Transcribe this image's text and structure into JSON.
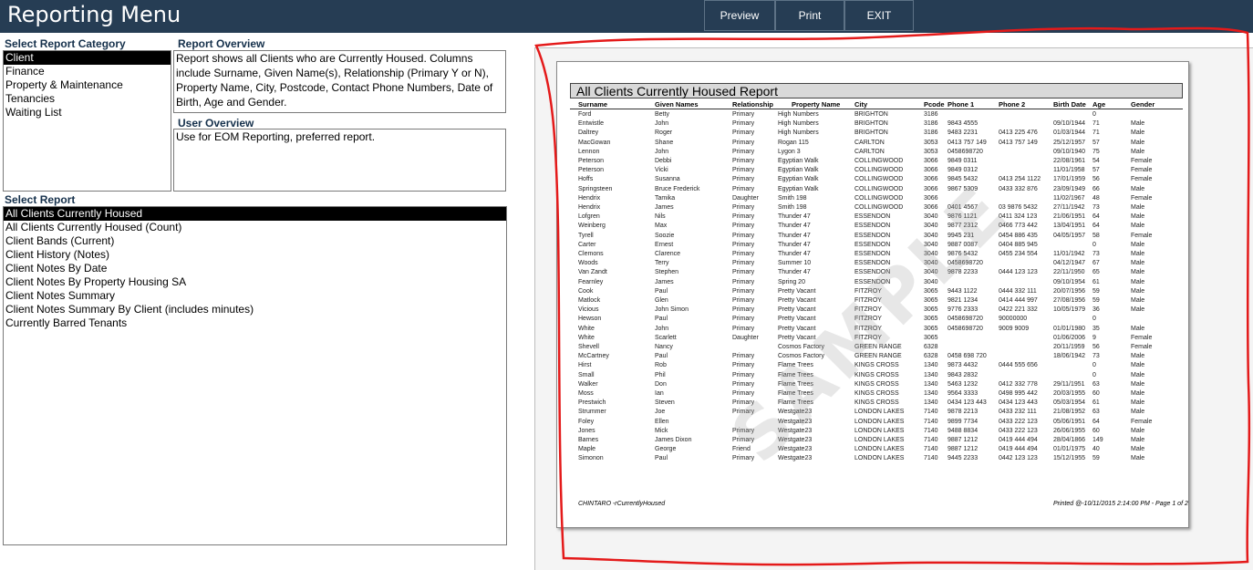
{
  "app_title": "Reporting Menu",
  "toolbar": {
    "preview": "Preview",
    "print": "Print",
    "exit": "EXIT"
  },
  "category": {
    "label": "Select Report Category",
    "items": [
      "Client",
      "Finance",
      "Property & Maintenance",
      "Tenancies",
      "Waiting List"
    ]
  },
  "overview": {
    "label": "Report Overview",
    "text": "Report shows all Clients who are Currently Housed. Columns include Surname, Given Name(s), Relationship (Primary Y or N), Property Name, City, Postcode, Contact Phone Numbers, Date of Birth, Age and Gender."
  },
  "user_overview": {
    "label": "User Overview",
    "text": "Use for EOM Reporting, preferred report."
  },
  "reports": {
    "label": "Select Report",
    "items": [
      "All Clients Currently Housed",
      "All Clients Currently Housed (Count)",
      "Client Bands (Current)",
      "Client History (Notes)",
      "Client Notes By Date",
      "Client Notes By Property Housing SA",
      "Client Notes Summary",
      "Client Notes Summary By Client (includes minutes)",
      "Currently Barred Tenants"
    ]
  },
  "preview": {
    "title": "All Clients Currently Housed Report",
    "columns": [
      "Surname",
      "Given Names",
      "Relationship",
      "Property Name",
      "City",
      "Pcode",
      "Phone 1",
      "Phone 2",
      "Birth Date",
      "Age",
      "Gender"
    ],
    "rows": [
      [
        "Ford",
        "Betty",
        "Primary",
        "High Numbers",
        "BRIGHTON",
        "3186",
        "",
        "",
        "",
        "0",
        ""
      ],
      [
        "Entwistle",
        "John",
        "Primary",
        "High Numbers",
        "BRIGHTON",
        "3186",
        "9843 4555",
        "",
        "09/10/1944",
        "71",
        "Male"
      ],
      [
        "Daltrey",
        "Roger",
        "Primary",
        "High Numbers",
        "BRIGHTON",
        "3186",
        "9483 2231",
        "0413 225 476",
        "01/03/1944",
        "71",
        "Male"
      ],
      [
        "MacGowan",
        "Shane",
        "Primary",
        "Rogan 115",
        "CARLTON",
        "3053",
        "0413 757 149",
        "0413 757 149",
        "25/12/1957",
        "57",
        "Male"
      ],
      [
        "Lennon",
        "John",
        "Primary",
        "Lygon 3",
        "CARLTON",
        "3053",
        "0458698720",
        "",
        "09/10/1940",
        "75",
        "Male"
      ],
      [
        "Peterson",
        "Debbi",
        "Primary",
        "Egyptian Walk",
        "COLLINGWOOD",
        "3066",
        "9849 0311",
        "",
        "22/08/1961",
        "54",
        "Female"
      ],
      [
        "Peterson",
        "Vicki",
        "Primary",
        "Egyptian Walk",
        "COLLINGWOOD",
        "3066",
        "9849 0312",
        "",
        "11/01/1958",
        "57",
        "Female"
      ],
      [
        "Hoffs",
        "Susanna",
        "Primary",
        "Egyptian Walk",
        "COLLINGWOOD",
        "3066",
        "9845 5432",
        "0413 254 1122",
        "17/01/1959",
        "56",
        "Female"
      ],
      [
        "Springsteen",
        "Bruce Frederick",
        "Primary",
        "Egyptian Walk",
        "COLLINGWOOD",
        "3066",
        "9867 5309",
        "0433 332 876",
        "23/09/1949",
        "66",
        "Male"
      ],
      [
        "Hendrix",
        "Tamika",
        "Daughter",
        "Smith 198",
        "COLLINGWOOD",
        "3066",
        "",
        "",
        "11/02/1967",
        "48",
        "Female"
      ],
      [
        "Hendrix",
        "James",
        "Primary",
        "Smith 198",
        "COLLINGWOOD",
        "3066",
        "0401 4567",
        "03 9876 5432",
        "27/11/1942",
        "73",
        "Male"
      ],
      [
        "Lofgren",
        "Nils",
        "Primary",
        "Thunder 47",
        "ESSENDON",
        "3040",
        "9876 1121",
        "0411 324 123",
        "21/06/1951",
        "64",
        "Male"
      ],
      [
        "Weinberg",
        "Max",
        "Primary",
        "Thunder 47",
        "ESSENDON",
        "3040",
        "9877 2312",
        "0466 773 442",
        "13/04/1951",
        "64",
        "Male"
      ],
      [
        "Tyrell",
        "Soozie",
        "Primary",
        "Thunder 47",
        "ESSENDON",
        "3040",
        "9945 231",
        "0454 886 435",
        "04/05/1957",
        "58",
        "Female"
      ],
      [
        "Carter",
        "Ernest",
        "Primary",
        "Thunder 47",
        "ESSENDON",
        "3040",
        "9887 0087",
        "0404 885 945",
        "",
        "0",
        "Male"
      ],
      [
        "Clemons",
        "Clarence",
        "Primary",
        "Thunder 47",
        "ESSENDON",
        "3040",
        "9876 5432",
        "0455 234 554",
        "11/01/1942",
        "73",
        "Male"
      ],
      [
        "Woods",
        "Terry",
        "Primary",
        "Summer 10",
        "ESSENDON",
        "3040",
        "0458698720",
        "",
        "04/12/1947",
        "67",
        "Male"
      ],
      [
        "Van Zandt",
        "Stephen",
        "Primary",
        "Thunder 47",
        "ESSENDON",
        "3040",
        "9878 2233",
        "0444 123 123",
        "22/11/1950",
        "65",
        "Male"
      ],
      [
        "Fearnley",
        "James",
        "Primary",
        "Spring 20",
        "ESSENDON",
        "3040",
        "",
        "",
        "09/10/1954",
        "61",
        "Male"
      ],
      [
        "Cook",
        "Paul",
        "Primary",
        "Pretty Vacant",
        "FITZROY",
        "3065",
        "9443 1122",
        "0444 332 111",
        "20/07/1956",
        "59",
        "Male"
      ],
      [
        "Matlock",
        "Glen",
        "Primary",
        "Pretty Vacant",
        "FITZROY",
        "3065",
        "9821 1234",
        "0414 444 997",
        "27/08/1956",
        "59",
        "Male"
      ],
      [
        "Vicious",
        "John Simon",
        "Primary",
        "Pretty Vacant",
        "FITZROY",
        "3065",
        "9776 2333",
        "0422 221 332",
        "10/05/1979",
        "36",
        "Male"
      ],
      [
        "Hewson",
        "Paul",
        "Primary",
        "Pretty Vacant",
        "FITZROY",
        "3065",
        "0458698720",
        "90000000",
        "",
        "0",
        ""
      ],
      [
        "White",
        "John",
        "Primary",
        "Pretty Vacant",
        "FITZROY",
        "3065",
        "0458698720",
        "9009 9009",
        "01/01/1980",
        "35",
        "Male"
      ],
      [
        "White",
        "Scarlett",
        "Daughter",
        "Pretty Vacant",
        "FITZROY",
        "3065",
        "",
        "",
        "01/06/2006",
        "9",
        "Female"
      ],
      [
        "Shevell",
        "Nancy",
        "",
        "Cosmos Factory",
        "GREEN RANGE",
        "6328",
        "",
        "",
        "20/11/1959",
        "56",
        "Female"
      ],
      [
        "McCartney",
        "Paul",
        "Primary",
        "Cosmos Factory",
        "GREEN RANGE",
        "6328",
        "0458 698 720",
        "",
        "18/06/1942",
        "73",
        "Male"
      ],
      [
        "Hirst",
        "Rob",
        "Primary",
        "Flame Trees",
        "KINGS CROSS",
        "1340",
        "9873 4432",
        "0444 555 656",
        "",
        "0",
        "Male"
      ],
      [
        "Small",
        "Phil",
        "Primary",
        "Flame Trees",
        "KINGS CROSS",
        "1340",
        "9843 2832",
        "",
        "",
        "0",
        "Male"
      ],
      [
        "Walker",
        "Don",
        "Primary",
        "Flame Trees",
        "KINGS CROSS",
        "1340",
        "5463 1232",
        "0412 332 778",
        "29/11/1951",
        "63",
        "Male"
      ],
      [
        "Moss",
        "Ian",
        "Primary",
        "Flame Trees",
        "KINGS CROSS",
        "1340",
        "9564 3333",
        "0498 995 442",
        "20/03/1955",
        "60",
        "Male"
      ],
      [
        "Prestwich",
        "Steven",
        "Primary",
        "Flame Trees",
        "KINGS CROSS",
        "1340",
        "0434 123 443",
        "0434 123 443",
        "05/03/1954",
        "61",
        "Male"
      ],
      [
        "Strummer",
        "Joe",
        "Primary",
        "Westgate23",
        "LONDON LAKES",
        "7140",
        "9878 2213",
        "0433 232 111",
        "21/08/1952",
        "63",
        "Male"
      ],
      [
        "Foley",
        "Ellen",
        "",
        "Westgate23",
        "LONDON LAKES",
        "7140",
        "9899 7734",
        "0433 222 123",
        "05/06/1951",
        "64",
        "Female"
      ],
      [
        "Jones",
        "Mick",
        "Primary",
        "Westgate23",
        "LONDON LAKES",
        "7140",
        "9488 8834",
        "0433 222 123",
        "26/06/1955",
        "60",
        "Male"
      ],
      [
        "Barnes",
        "James Dixon",
        "Primary",
        "Westgate23",
        "LONDON LAKES",
        "7140",
        "9887 1212",
        "0419 444 494",
        "28/04/1866",
        "149",
        "Male"
      ],
      [
        "Maple",
        "George",
        "Friend",
        "Westgate23",
        "LONDON LAKES",
        "7140",
        "9887 1212",
        "0419 444 494",
        "01/01/1975",
        "40",
        "Male"
      ],
      [
        "Simonon",
        "Paul",
        "Primary",
        "Westgate23",
        "LONDON LAKES",
        "7140",
        "9445 2233",
        "0442 123 123",
        "15/12/1955",
        "59",
        "Male"
      ]
    ],
    "footer_left": "CHINTARO -rCurrentlyHoused",
    "footer_right": "Printed @-10/11/2015 2:14:00 PM - Page 1 of 2",
    "watermark": "SAMPLE"
  },
  "colors": {
    "header_bg": "#263d54",
    "label_text": "#15304b",
    "annotation": "#e41a1a"
  }
}
